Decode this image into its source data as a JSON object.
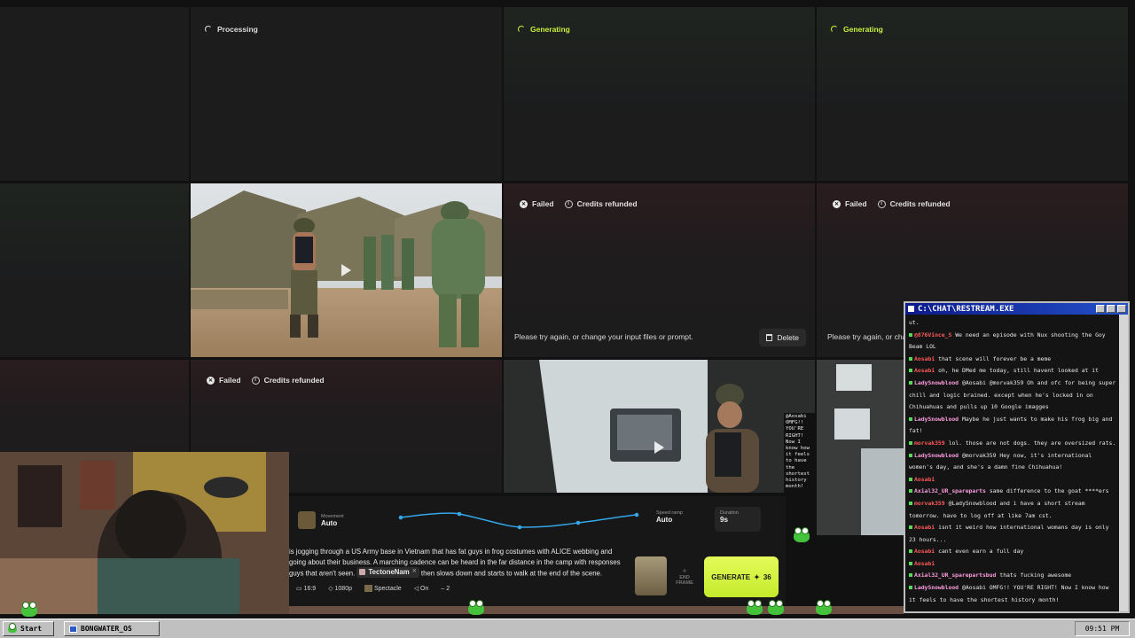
{
  "status": {
    "processing": "Processing",
    "generating": "Generating",
    "failed": "Failed",
    "credits_refunded": "Credits refunded",
    "retry_hint": "Please try again, or change your input files or prompt.",
    "retry_hint_cut": "Please try again, or char",
    "delete": "Delete"
  },
  "overlay_note": {
    "lines": [
      "@Aosabi",
      "OMFG!!",
      "YOU'RE",
      "RIGHT!",
      "Now I",
      "know how",
      "it feels",
      "to have",
      "the",
      "shortest",
      "history",
      "month!"
    ]
  },
  "controls": {
    "movement_label": "Movement",
    "movement_value": "Auto",
    "speed_ramp_label": "Speed ramp",
    "speed_ramp_value": "Auto",
    "duration_label": "Duration",
    "duration_value": "9s"
  },
  "prompt": {
    "line1": "is jogging through a US Army base in Vietnam that has fat guys in frog costumes with ALICE webbing and",
    "line2": "going about their business. A marching cadence can be heard in the far distance in the camp with responses",
    "line3_a": "guys that aren't seen.",
    "tag": "TectoneNam",
    "line3_b": "then slows down and starts to walk at the end of the scene.",
    "end_frame": "END FRAME"
  },
  "options": {
    "aspect": "16:9",
    "resolution": "1080p",
    "style": "Spectacle",
    "audio": "On",
    "count": "2"
  },
  "generate": {
    "label": "GENERATE",
    "cost": "36"
  },
  "chat": {
    "title": "C:\\CHAT\\RESTREAM.EXE",
    "messages": [
      {
        "user": "",
        "text": "ut.",
        "color": "#e8e8e8"
      },
      {
        "user": "@876Vince_S",
        "text": "We need an episode with Nux shooting the Goy Beam LOL",
        "color": "#ff5a5a"
      },
      {
        "user": "Aosabi",
        "text": "that scene will forever be a meme",
        "color": "#ff5a5a"
      },
      {
        "user": "Aosabi",
        "text": "oh, he DMed me today, still havent looked at it",
        "color": "#ff5a5a"
      },
      {
        "user": "LadySnowblood",
        "text": "@Aosabi @morvak359 Oh and ofc for being super chill and logic brained. except when he's locked in on Chihuahuas and pulls up 10 Google imagges",
        "color": "#ff9de0"
      },
      {
        "user": "LadySnowblood",
        "text": "Maybe he just wants to make his frog big and fat!",
        "color": "#ff9de0"
      },
      {
        "user": "morvak359",
        "text": "lol. those are not dogs. they are oversized rats.",
        "color": "#ff5a5a"
      },
      {
        "user": "LadySnowblood",
        "text": "@morvak359 Hey now, it's international women's day, and she's a damn fine Chihuahua!",
        "color": "#ff9de0"
      },
      {
        "user": "Aosabi",
        "text": "",
        "color": "#ff5a5a"
      },
      {
        "user": "Axial32_UR_spareparts",
        "text": "same difference to the goat ****ers",
        "color": "#ff9de0"
      },
      {
        "user": "morvak359",
        "text": "@LadySnowblood and i have a short stream tomorrow. have to log off at like 7am cst.",
        "color": "#ff5a5a"
      },
      {
        "user": "Aosabi",
        "text": "isnt it weird how international womans day is only 23 hours...",
        "color": "#ff5a5a"
      },
      {
        "user": "Aosabi",
        "text": "cant even earn a full day",
        "color": "#ff5a5a"
      },
      {
        "user": "Aosabi",
        "text": "",
        "color": "#ff5a5a"
      },
      {
        "user": "Axial32_UR_sparepartsbud",
        "text": "thats fucking awesome",
        "color": "#ff9de0"
      },
      {
        "user": "LadySnowblood",
        "text": "@Aosabi OMFG!! YOU'RE RIGHT! Now I know how it feels to have the shortest history month!",
        "color": "#ff9de0"
      }
    ]
  },
  "taskbar": {
    "start": "Start",
    "window": "BONGWATER_OS",
    "clock": "09:51 PM"
  }
}
